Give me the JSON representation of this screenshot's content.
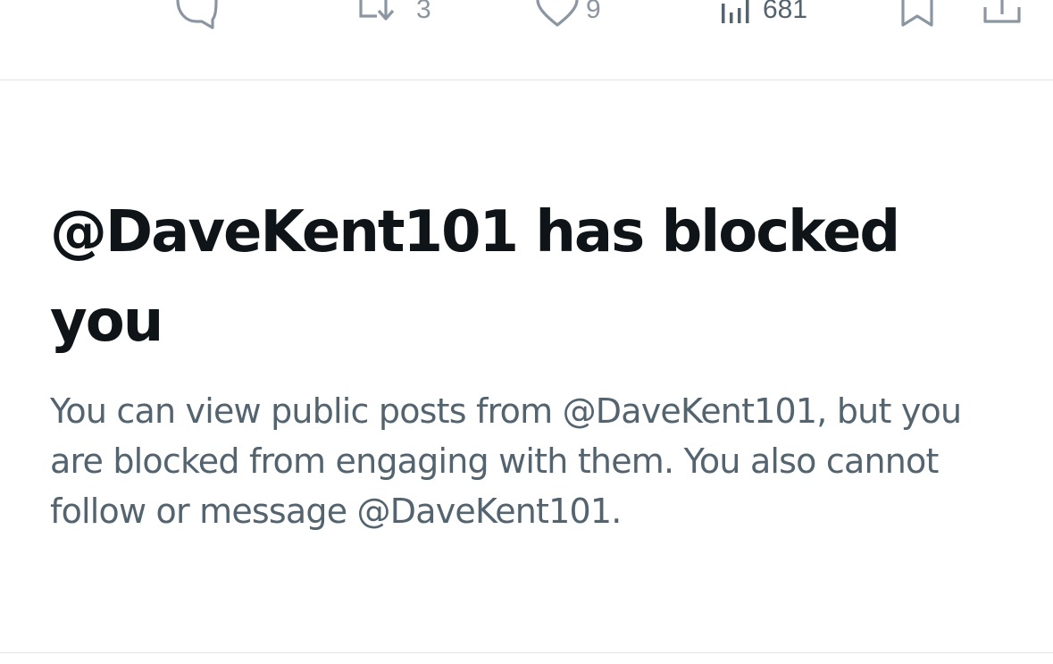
{
  "tweet_actions": {
    "reply": {
      "icon": "reply-icon",
      "count": ""
    },
    "repost": {
      "icon": "repost-icon",
      "count": "3"
    },
    "like": {
      "icon": "heart-icon",
      "count": "9"
    },
    "views": {
      "icon": "views-chart-icon",
      "count": "681"
    },
    "bookmark": {
      "icon": "bookmark-icon",
      "count": ""
    },
    "share": {
      "icon": "share-icon",
      "count": ""
    }
  },
  "blocked_notice": {
    "title": "@DaveKent101 has blocked you",
    "description": "You can view public posts from @DaveKent101, but you are blocked from engaging with them. You also cannot follow or message @DaveKent101."
  },
  "colors": {
    "title_text": "#0f1419",
    "secondary_text": "#536471",
    "icon_gray": "#8a97a3",
    "divider": "#dfe3e6",
    "background": "#ffffff"
  }
}
